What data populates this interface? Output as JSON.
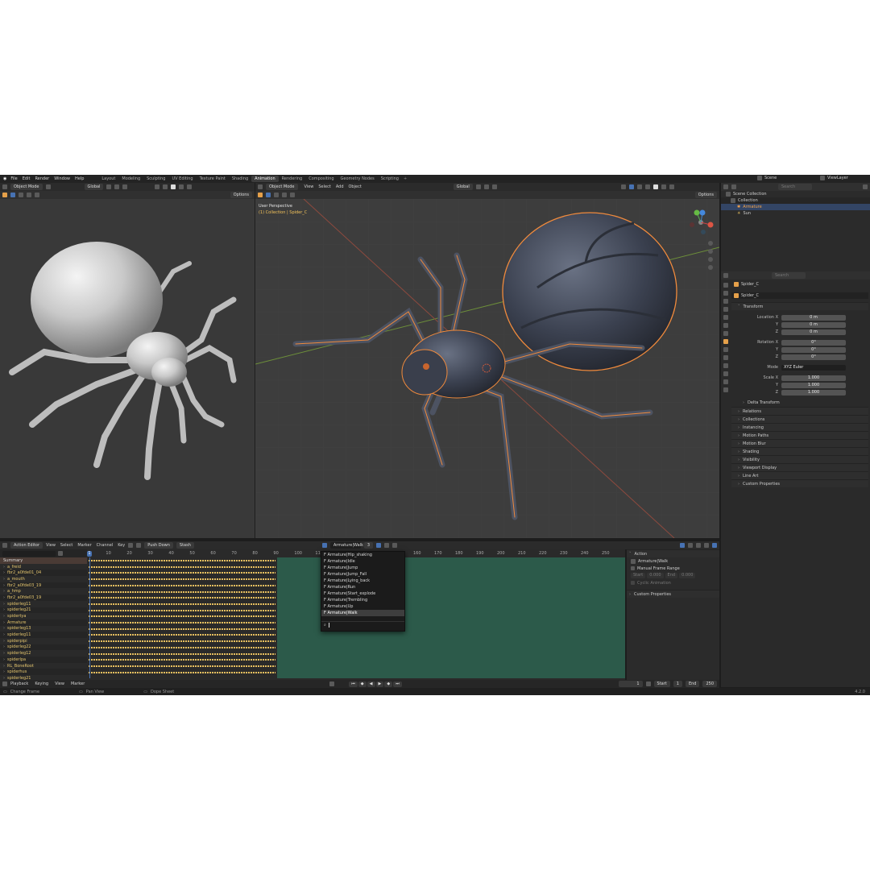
{
  "topbar": {
    "menus": [
      "File",
      "Edit",
      "Render",
      "Window",
      "Help"
    ],
    "workspaces": [
      "Layout",
      "Modeling",
      "Sculpting",
      "UV Editing",
      "Texture Paint",
      "Shading",
      "Animation",
      "Rendering",
      "Compositing",
      "Geometry Nodes",
      "Scripting"
    ],
    "active_workspace": "Animation",
    "add_tab": "+",
    "scene_label": "Scene",
    "viewlayer_label": "ViewLayer"
  },
  "left_viewport": {
    "mode": "Object Mode",
    "transform": "Global",
    "options": "Options"
  },
  "main_viewport": {
    "mode": "Object Mode",
    "menus": [
      "View",
      "Select",
      "Add",
      "Object"
    ],
    "transform": "Global",
    "options": "Options",
    "overlay_title": "User Perspective",
    "overlay_sub": "(1) Collection | Spider_C"
  },
  "outliner": {
    "search_placeholder": "Search",
    "scene_collection": "Scene Collection",
    "collection": "Collection",
    "items": [
      "Armature",
      "Sun"
    ]
  },
  "properties": {
    "search_placeholder": "Search",
    "object_name": "Spider_C",
    "datablock_name": "Spider_C",
    "transform_title": "Transform",
    "location_label": "Location X",
    "location": [
      "0 m",
      "0 m",
      "0 m"
    ],
    "rotation_label": "Rotation X",
    "rotation": [
      "0°",
      "0°",
      "0°"
    ],
    "mode_label": "Mode",
    "mode_value": "XYZ Euler",
    "scale_label": "Scale X",
    "scale": [
      "1.000",
      "1.000",
      "1.000"
    ],
    "axis_y": "Y",
    "axis_z": "Z",
    "delta": "Delta Transform",
    "sections": [
      "Relations",
      "Collections",
      "Instancing",
      "Motion Paths",
      "Motion Blur",
      "Shading",
      "Visibility",
      "Viewport Display",
      "Line Art",
      "Custom Properties"
    ]
  },
  "action_editor": {
    "editor_label": "Action Editor",
    "menus": [
      "View",
      "Select",
      "Marker",
      "Channel",
      "Key"
    ],
    "push_down": "Push Down",
    "stash": "Stash",
    "action_name": "Armature|Walk",
    "users": "3",
    "channels": [
      "Summary",
      "a_freid",
      "fbr2_a0fde01_04",
      "a_mouth",
      "fbr2_a0fde03_19",
      "a_hmp",
      "fbr2_a0fde03_19",
      "spiderleg11",
      "spiderleg21",
      "spidertya",
      "Armature",
      "spiderleg13",
      "spiderleg11",
      "spiderpipi",
      "spiderleg22",
      "spiderleg12",
      "spiderlpa",
      "RL_BoneRoot",
      "spiderhus",
      "spiderleg21"
    ],
    "ticks": [
      "1",
      "10",
      "20",
      "30",
      "40",
      "50",
      "60",
      "70",
      "80",
      "90",
      "100",
      "110",
      "160",
      "170",
      "180",
      "190",
      "200",
      "210",
      "220",
      "230",
      "240",
      "250"
    ],
    "current_frame": "1",
    "dropdown": [
      "F Armature|Hip_shaking",
      "F Armature|Idle",
      "F Armature|Jump",
      "F Armature|Jump_Fall",
      "F Armature|Lying_back",
      "F Armature|Run",
      "F Armature|Start_explode",
      "F Armature|Trembling",
      "F Armature|Up",
      "F Armature|Walk"
    ],
    "dropdown_selected": "F Armature|Walk"
  },
  "action_sidebar": {
    "action_title": "Action",
    "action_name": "Armature|Walk",
    "manual_range": "Manual Frame Range",
    "start_label": "Start",
    "start_value": "0.000",
    "end_label": "End",
    "end_value": "0.000",
    "cyclic": "Cyclic Animation",
    "custom_props": "Custom Properties"
  },
  "timeline": {
    "menus": [
      "Playback",
      "Keying",
      "View",
      "Marker"
    ],
    "frame": "1",
    "start_label": "Start",
    "start": "1",
    "end_label": "End",
    "end": "250"
  },
  "statusbar": {
    "left": "Change Frame",
    "mid": "Pan View",
    "right": "Dope Sheet",
    "version": "4.2.0"
  },
  "colors": {
    "accent": "#4772b3",
    "selection_orange": "#f08a3c",
    "keyframe": "#e8c060",
    "nla_green": "#2c5a4a"
  }
}
